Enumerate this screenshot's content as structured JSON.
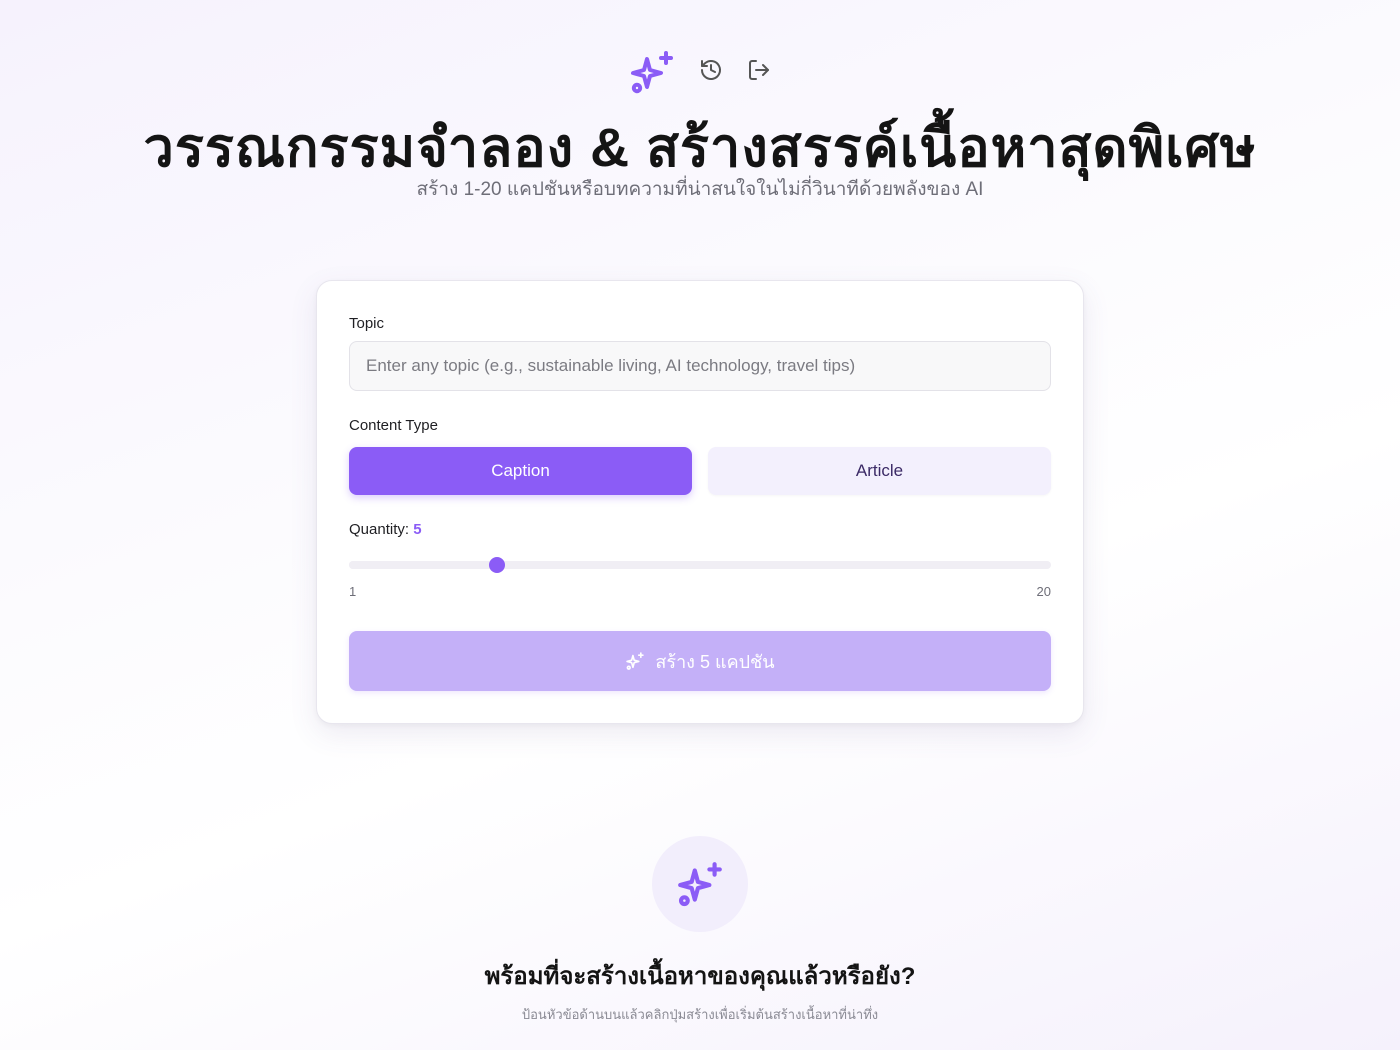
{
  "header": {
    "title": "วรรณกรรมจำลอง & สร้างสรรค์เนื้อหาสุดพิเศษ",
    "subtitle": "สร้าง 1-20 แคปชันหรือบทความที่น่าสนใจในไม่กี่วินาทีด้วยพลังของ AI"
  },
  "form": {
    "topic_label": "Topic",
    "topic_placeholder": "Enter any topic (e.g., sustainable living, AI technology, travel tips)",
    "topic_value": "",
    "content_type_label": "Content Type",
    "options": [
      "Caption",
      "Article"
    ],
    "selected_option": "Caption",
    "quantity_label": "Quantity:",
    "quantity_value": "5",
    "quantity_fraction": 0.2105,
    "range_min": "1",
    "range_max": "20",
    "generate_label": "สร้าง 5 แคปชัน"
  },
  "empty_state": {
    "title": "พร้อมที่จะสร้างเนื้อหาของคุณแล้วหรือยัง?",
    "subtitle": "ป้อนหัวข้อด้านบนแล้วคลิกปุ่มสร้างเพื่อเริ่มต้นสร้างเนื้อหาที่น่าทึ่ง"
  },
  "colors": {
    "accent": "#8b5cf6",
    "accent_disabled": "#c4b0f8",
    "accent_soft": "#f3f0fd"
  },
  "icons": [
    "sparkles-icon",
    "history-icon",
    "logout-icon"
  ]
}
